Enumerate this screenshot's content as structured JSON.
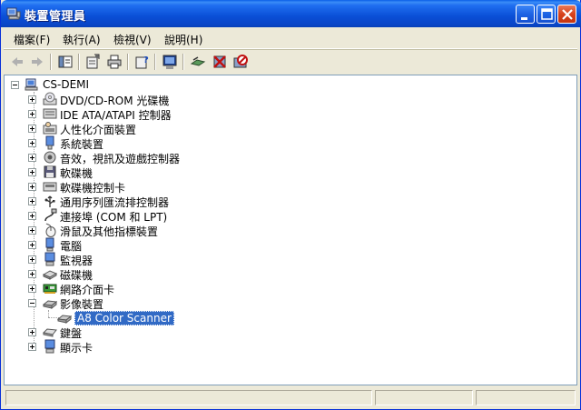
{
  "window": {
    "title": "裝置管理員",
    "title_icon": "device-manager-icon",
    "controls": [
      "minimize-icon",
      "maximize-icon",
      "close-icon"
    ]
  },
  "menu": {
    "items": [
      {
        "label": "檔案(F)"
      },
      {
        "label": "執行(A)"
      },
      {
        "label": "檢視(V)"
      },
      {
        "label": "說明(H)"
      }
    ]
  },
  "toolbar": {
    "buttons": [
      "back-icon",
      "forward-icon",
      "show-hide-tree-icon",
      "properties-icon",
      "print-icon",
      "help-icon",
      "scan-hardware-icon",
      "update-driver-icon",
      "uninstall-icon",
      "disable-icon"
    ]
  },
  "tree": {
    "root": {
      "label": "CS-DEMI",
      "icon": "computer-icon",
      "expanded": true
    },
    "items": [
      {
        "label": "DVD/CD-ROM 光碟機",
        "icon": "dvd-drive-icon",
        "expanded": false
      },
      {
        "label": "IDE ATA/ATAPI 控制器",
        "icon": "ide-controller-icon",
        "expanded": false
      },
      {
        "label": "人性化介面裝置",
        "icon": "hid-icon",
        "expanded": false
      },
      {
        "label": "系統裝置",
        "icon": "system-device-icon",
        "expanded": false
      },
      {
        "label": "音效，視訊及遊戲控制器",
        "icon": "sound-icon",
        "expanded": false
      },
      {
        "label": "軟碟機",
        "icon": "floppy-icon",
        "expanded": false
      },
      {
        "label": "軟碟機控制卡",
        "icon": "floppy-controller-icon",
        "expanded": false
      },
      {
        "label": "通用序列匯流排控制器",
        "icon": "usb-icon",
        "expanded": false
      },
      {
        "label": "連接埠 (COM 和 LPT)",
        "icon": "port-icon",
        "expanded": false
      },
      {
        "label": "滑鼠及其他指標裝置",
        "icon": "mouse-icon",
        "expanded": false
      },
      {
        "label": "電腦",
        "icon": "computer-class-icon",
        "expanded": false
      },
      {
        "label": "監視器",
        "icon": "monitor-icon",
        "expanded": false
      },
      {
        "label": "磁碟機",
        "icon": "disk-drive-icon",
        "expanded": false
      },
      {
        "label": "網路介面卡",
        "icon": "network-adapter-icon",
        "expanded": false
      },
      {
        "label": "影像裝置",
        "icon": "imaging-device-icon",
        "expanded": true,
        "children": [
          {
            "label": "A8 Color Scanner",
            "icon": "scanner-icon",
            "selected": true
          }
        ]
      },
      {
        "label": "鍵盤",
        "icon": "keyboard-icon",
        "expanded": false
      },
      {
        "label": "顯示卡",
        "icon": "display-adapter-icon",
        "expanded": false
      }
    ]
  },
  "statusbar": {
    "text": ""
  },
  "colors": {
    "titlebar": "#0a4fd6",
    "selection": "#316ac5",
    "window_bg": "#ece9d8"
  }
}
